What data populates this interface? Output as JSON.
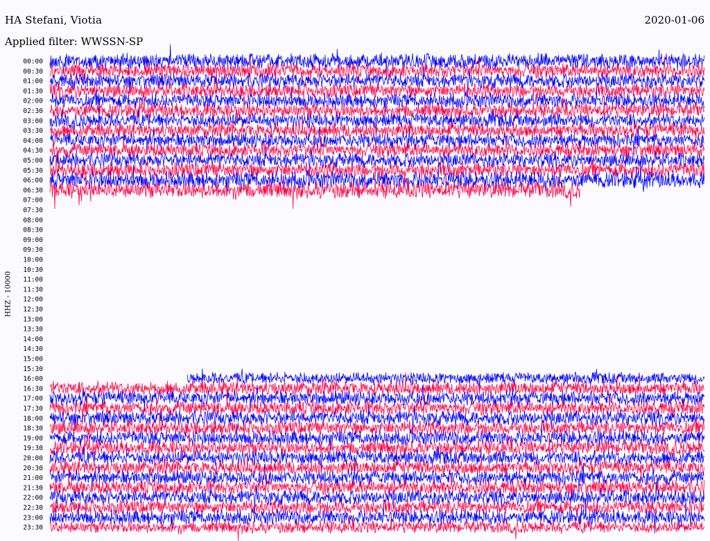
{
  "header": {
    "station": "HA Stefani, Viotia",
    "date": "2020-01-06",
    "filter": "Applied filter: WWSSN-SP"
  },
  "chart_data": {
    "type": "line",
    "title": "HA Stefani, Viotia",
    "date": "2020-01-06",
    "filter": "WWSSN-SP",
    "ylabel": "HHZ - 10000",
    "row_labels": [
      "00:00",
      "00:30",
      "01:00",
      "01:30",
      "02:00",
      "02:30",
      "03:00",
      "03:30",
      "04:00",
      "04:30",
      "05:00",
      "05:30",
      "06:00",
      "06:30",
      "07:00",
      "07:30",
      "08:00",
      "08:30",
      "09:00",
      "09:30",
      "10:00",
      "10:30",
      "11:00",
      "11:30",
      "12:00",
      "12:30",
      "13:00",
      "13:30",
      "14:00",
      "14:30",
      "15:00",
      "15:30",
      "16:00",
      "16:30",
      "17:00",
      "17:30",
      "18:00",
      "18:30",
      "19:00",
      "19:30",
      "20:00",
      "20:30",
      "21:00",
      "21:30",
      "22:00",
      "22:30",
      "23:00",
      "23:30"
    ],
    "series_colors": [
      "#0000ff",
      "#ff0040"
    ],
    "traces": [
      {
        "row": "00:00",
        "start": 0.0,
        "end": 1.0,
        "amplitude": 13
      },
      {
        "row": "00:30",
        "start": 0.0,
        "end": 1.0,
        "amplitude": 12
      },
      {
        "row": "01:00",
        "start": 0.0,
        "end": 1.0,
        "amplitude": 12
      },
      {
        "row": "01:30",
        "start": 0.0,
        "end": 1.0,
        "amplitude": 12
      },
      {
        "row": "02:00",
        "start": 0.0,
        "end": 1.0,
        "amplitude": 12
      },
      {
        "row": "02:30",
        "start": 0.0,
        "end": 1.0,
        "amplitude": 12
      },
      {
        "row": "03:00",
        "start": 0.0,
        "end": 1.0,
        "amplitude": 12
      },
      {
        "row": "03:30",
        "start": 0.0,
        "end": 1.0,
        "amplitude": 12
      },
      {
        "row": "04:00",
        "start": 0.0,
        "end": 1.0,
        "amplitude": 12
      },
      {
        "row": "04:30",
        "start": 0.0,
        "end": 1.0,
        "amplitude": 12
      },
      {
        "row": "05:00",
        "start": 0.0,
        "end": 1.0,
        "amplitude": 12
      },
      {
        "row": "05:30",
        "start": 0.0,
        "end": 1.0,
        "amplitude": 13
      },
      {
        "row": "06:00",
        "start": 0.0,
        "end": 1.0,
        "amplitude": 14
      },
      {
        "row": "06:30",
        "start": 0.0,
        "end": 0.81,
        "amplitude": 14
      },
      {
        "row": "16:00",
        "start": 0.21,
        "end": 1.0,
        "amplitude": 10
      },
      {
        "row": "16:30",
        "start": 0.0,
        "end": 1.0,
        "amplitude": 12
      },
      {
        "row": "17:00",
        "start": 0.0,
        "end": 1.0,
        "amplitude": 12
      },
      {
        "row": "17:30",
        "start": 0.0,
        "end": 1.0,
        "amplitude": 12
      },
      {
        "row": "18:00",
        "start": 0.0,
        "end": 1.0,
        "amplitude": 12
      },
      {
        "row": "18:30",
        "start": 0.0,
        "end": 1.0,
        "amplitude": 12
      },
      {
        "row": "19:00",
        "start": 0.0,
        "end": 1.0,
        "amplitude": 12
      },
      {
        "row": "19:30",
        "start": 0.0,
        "end": 1.0,
        "amplitude": 12
      },
      {
        "row": "20:00",
        "start": 0.0,
        "end": 1.0,
        "amplitude": 12
      },
      {
        "row": "20:30",
        "start": 0.0,
        "end": 1.0,
        "amplitude": 12
      },
      {
        "row": "21:00",
        "start": 0.0,
        "end": 1.0,
        "amplitude": 12
      },
      {
        "row": "21:30",
        "start": 0.0,
        "end": 1.0,
        "amplitude": 12
      },
      {
        "row": "22:00",
        "start": 0.0,
        "end": 1.0,
        "amplitude": 12
      },
      {
        "row": "22:30",
        "start": 0.0,
        "end": 1.0,
        "amplitude": 12
      },
      {
        "row": "23:00",
        "start": 0.0,
        "end": 1.0,
        "amplitude": 12
      },
      {
        "row": "23:30",
        "start": 0.0,
        "end": 1.0,
        "amplitude": 10
      }
    ]
  }
}
